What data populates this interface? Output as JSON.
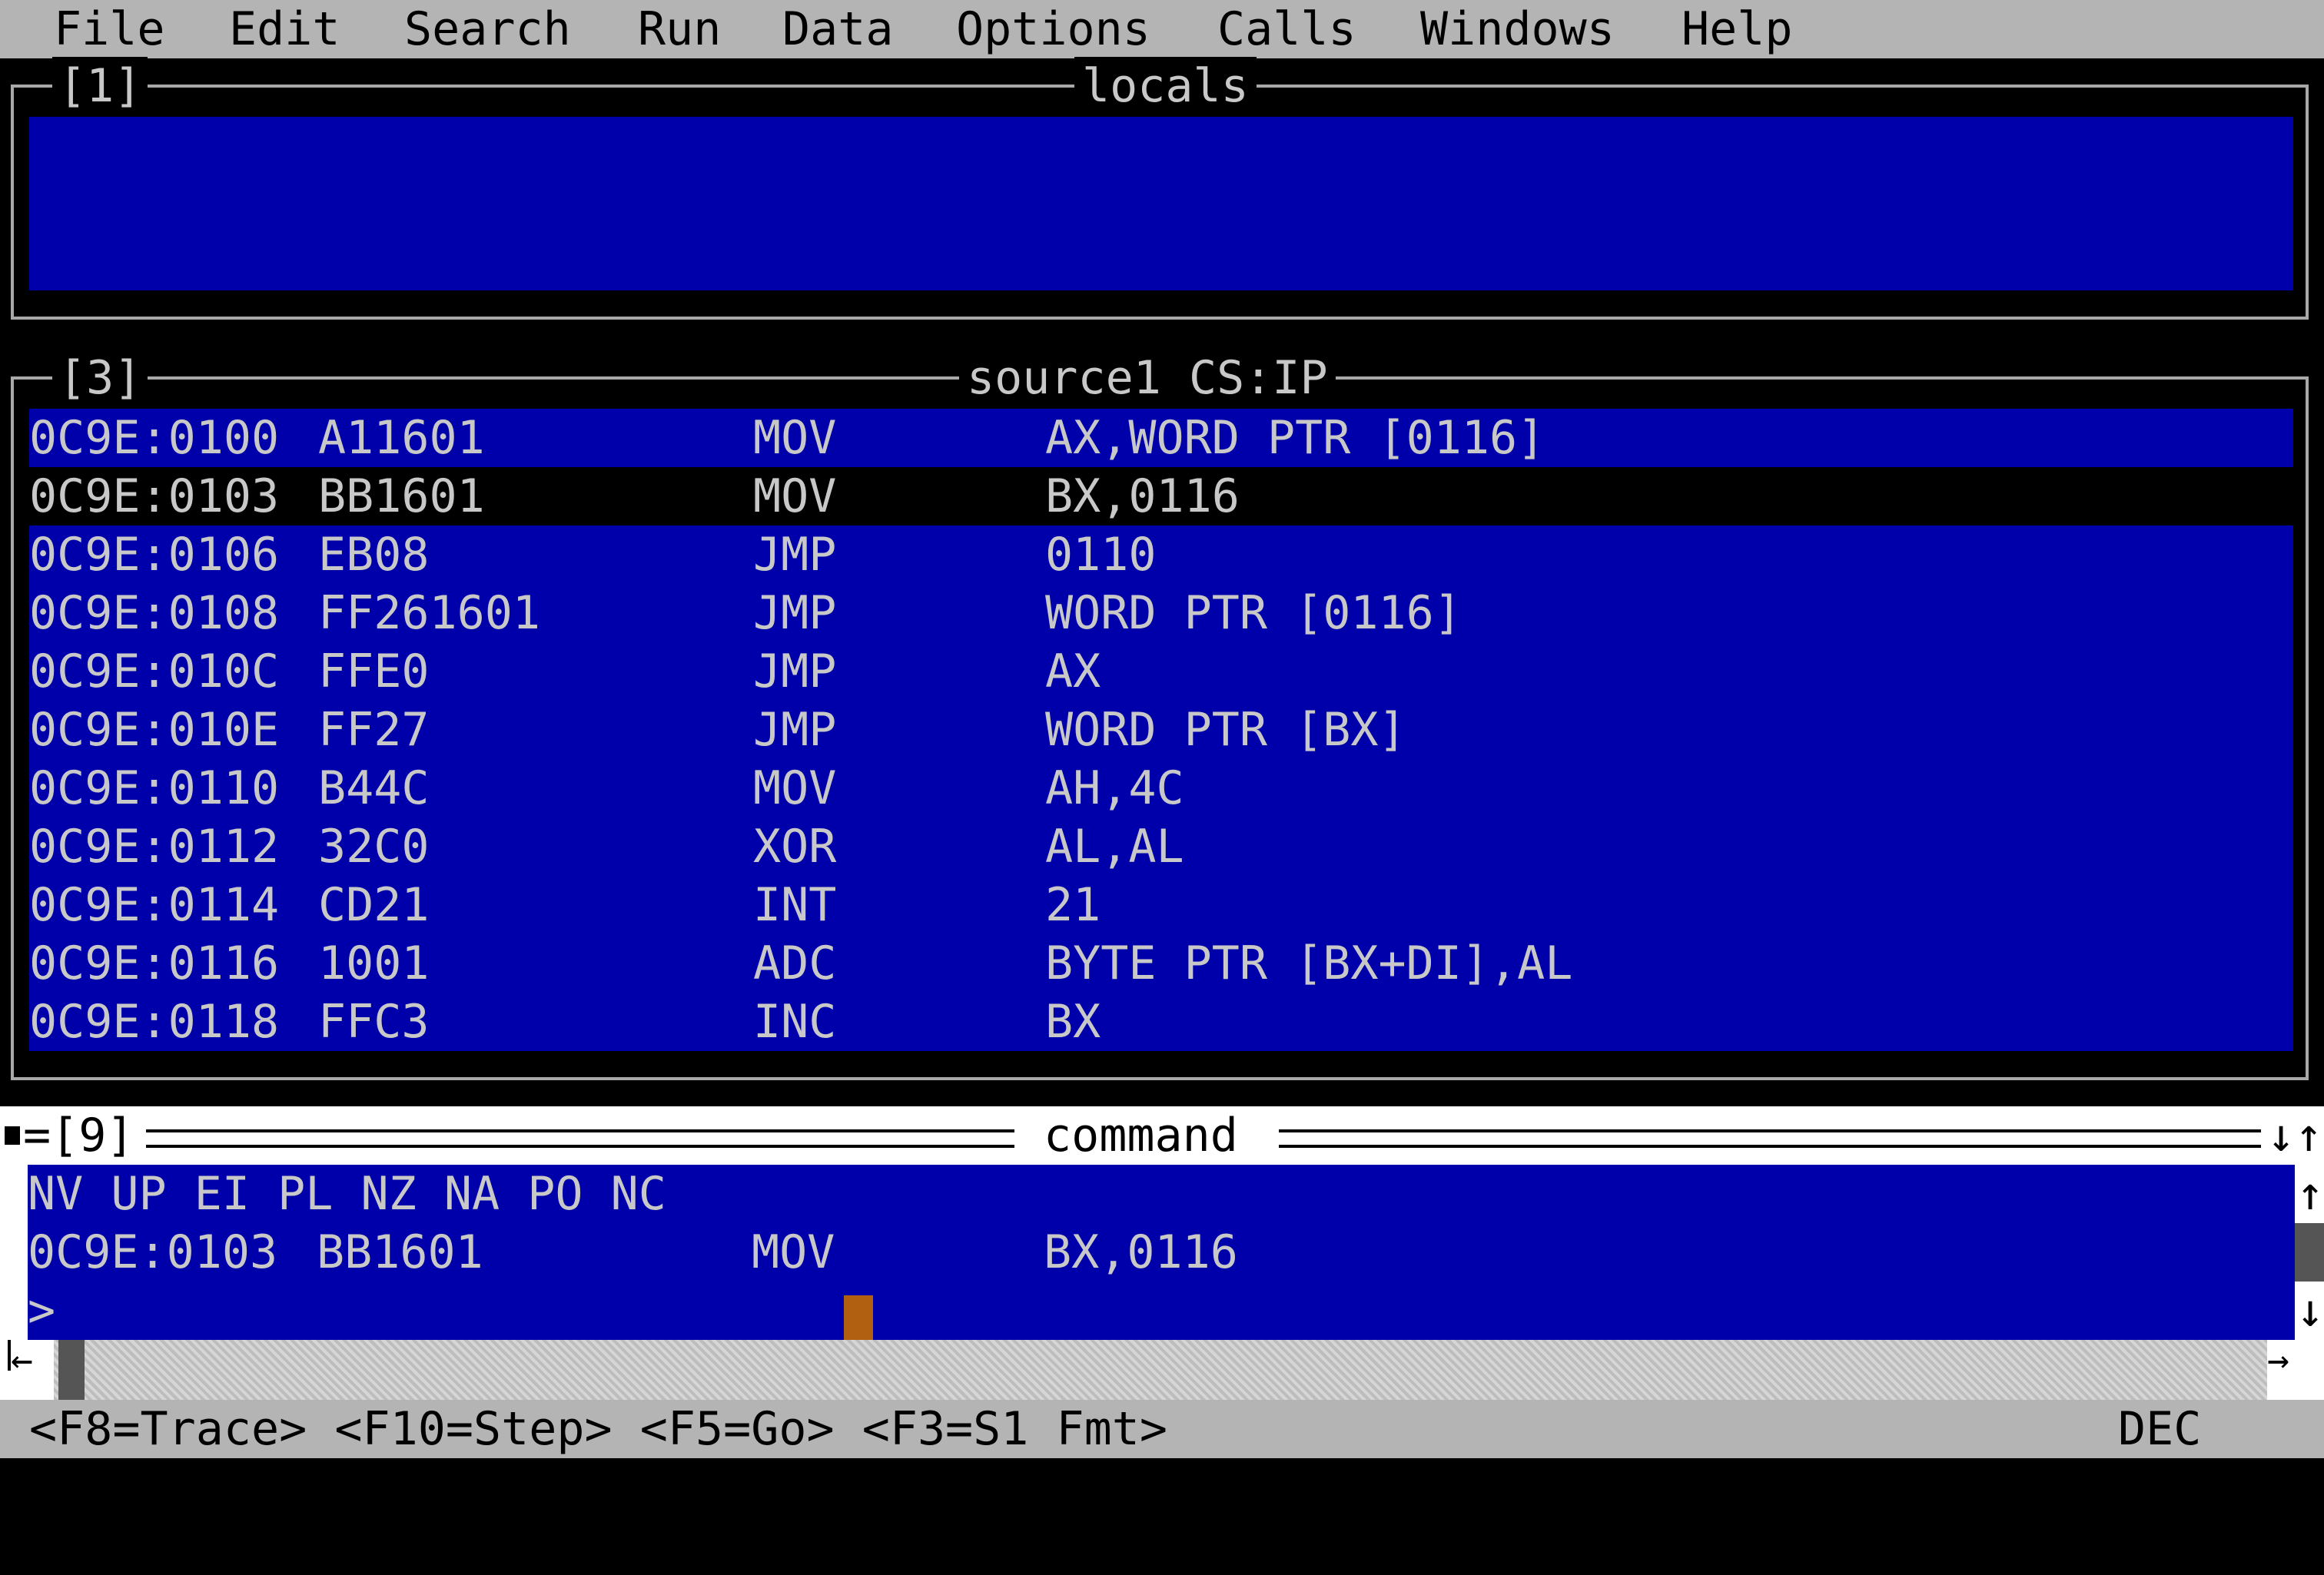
{
  "menu": [
    "File",
    "Edit",
    "Search",
    "Run",
    "Data",
    "Options",
    "Calls",
    "Windows",
    "Help"
  ],
  "locals_window": {
    "number": "[1]",
    "title": "locals"
  },
  "source_window": {
    "number": "[3]",
    "title": "source1 CS:IP",
    "lines": [
      {
        "addr": "0C9E:0100",
        "bytes": "A11601",
        "op": "MOV",
        "args": "AX,WORD PTR [0116]"
      },
      {
        "addr": "0C9E:0103",
        "bytes": "BB1601",
        "op": "MOV",
        "args": "BX,0116"
      },
      {
        "addr": "0C9E:0106",
        "bytes": "EB08",
        "op": "JMP",
        "args": "0110"
      },
      {
        "addr": "0C9E:0108",
        "bytes": "FF261601",
        "op": "JMP",
        "args": "WORD PTR [0116]"
      },
      {
        "addr": "0C9E:010C",
        "bytes": "FFE0",
        "op": "JMP",
        "args": "AX"
      },
      {
        "addr": "0C9E:010E",
        "bytes": "FF27",
        "op": "JMP",
        "args": "WORD PTR [BX]"
      },
      {
        "addr": "0C9E:0110",
        "bytes": "B44C",
        "op": "MOV",
        "args": "AH,4C"
      },
      {
        "addr": "0C9E:0112",
        "bytes": "32C0",
        "op": "XOR",
        "args": "AL,AL"
      },
      {
        "addr": "0C9E:0114",
        "bytes": "CD21",
        "op": "INT",
        "args": "21"
      },
      {
        "addr": "0C9E:0116",
        "bytes": "1001",
        "op": "ADC",
        "args": "BYTE PTR [BX+DI],AL"
      },
      {
        "addr": "0C9E:0118",
        "bytes": "FFC3",
        "op": "INC",
        "args": "BX"
      }
    ]
  },
  "command_window": {
    "number": "[9]",
    "title": "command",
    "flags": "NV UP EI PL NZ NA PO NC",
    "current": {
      "addr": "0C9E:0103",
      "bytes": "BB1601",
      "op": "MOV",
      "args": "BX,0116"
    },
    "prompt": ">"
  },
  "statusbar": {
    "keys": "<F8=Trace> <F10=Step> <F5=Go> <F3=S1 Fmt>",
    "mode": "DEC"
  },
  "colors": {
    "background": "#000000",
    "menu": "#b4b4b4",
    "window_blue": "#0000aa",
    "text": "#c8c8c8",
    "cursor": "#b06010"
  },
  "icons": [
    "scroll-up-icon",
    "scroll-down-icon",
    "scroll-left-icon",
    "scroll-right-icon",
    "resize-icon",
    "maximize-icon"
  ]
}
